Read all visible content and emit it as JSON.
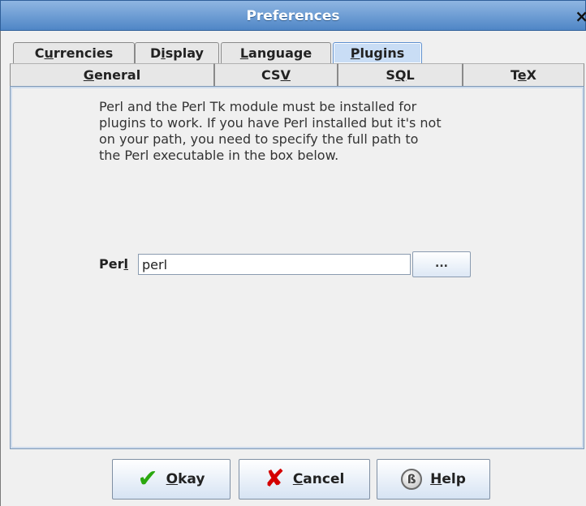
{
  "window": {
    "title": "Preferences",
    "close_glyph": "×"
  },
  "tabs": {
    "row1": [
      {
        "label_before": "C",
        "label_ul": "u",
        "label_after": "rrencies"
      },
      {
        "label_before": "D",
        "label_ul": "i",
        "label_after": "splay"
      },
      {
        "label_before": "",
        "label_ul": "L",
        "label_after": "anguage"
      },
      {
        "label_before": "",
        "label_ul": "P",
        "label_after": "lugins",
        "selected": true
      }
    ],
    "row2": [
      {
        "label_before": "",
        "label_ul": "G",
        "label_after": "eneral"
      },
      {
        "label_before": "CS",
        "label_ul": "V",
        "label_after": ""
      },
      {
        "label_before": "S",
        "label_ul": "Q",
        "label_after": "L"
      },
      {
        "label_before": "T",
        "label_ul": "e",
        "label_after": "X"
      }
    ]
  },
  "plugins": {
    "message": "Perl and the Perl Tk module must be installed for\nplugins to work. If you have Perl installed but it's not\non your path, you need to specify the full path to\nthe Perl executable in the box below.",
    "perl_label_before": "Per",
    "perl_label_ul": "l",
    "perl_value": "perl",
    "browse_label": "..."
  },
  "buttons": {
    "okay": {
      "ul": "O",
      "rest": "kay",
      "icon": "checkmark-icon"
    },
    "cancel": {
      "ul": "C",
      "rest": "ancel",
      "icon": "x-icon"
    },
    "help": {
      "ul": "H",
      "rest": "elp",
      "icon": "help-icon",
      "icon_glyph": "ß"
    }
  },
  "colors": {
    "titlebar": "#4f86c6",
    "selected_tab": "#c9ddf5",
    "check": "#2aa80f",
    "cancel_x": "#d40000"
  }
}
